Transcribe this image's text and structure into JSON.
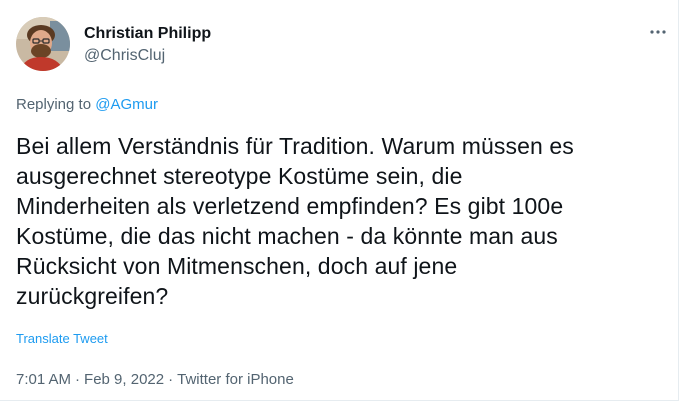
{
  "tweet": {
    "author": {
      "display_name": "Christian Philipp",
      "handle": "@ChrisCluj"
    },
    "more_icon": "more-horizontal-icon",
    "reply": {
      "prefix": "Replying to ",
      "mention": "@AGmur"
    },
    "text": "Bei allem Verständnis für Tradition. Warum müssen es\nausgerechnet stereotype Kostüme sein, die\nMinderheiten als verletzend empfinden? Es gibt 100e\nKostüme, die das nicht machen - da könnte man aus\nRücksicht von Mitmenschen, doch auf jene\nzurückgreifen?",
    "translate_label": "Translate Tweet",
    "meta": {
      "time": "7:01 AM",
      "separator": "·",
      "date": "Feb 9, 2022",
      "source": "Twitter for iPhone"
    }
  },
  "colors": {
    "text": "#0f1419",
    "secondary": "#536471",
    "accent": "#1d9bf0"
  }
}
